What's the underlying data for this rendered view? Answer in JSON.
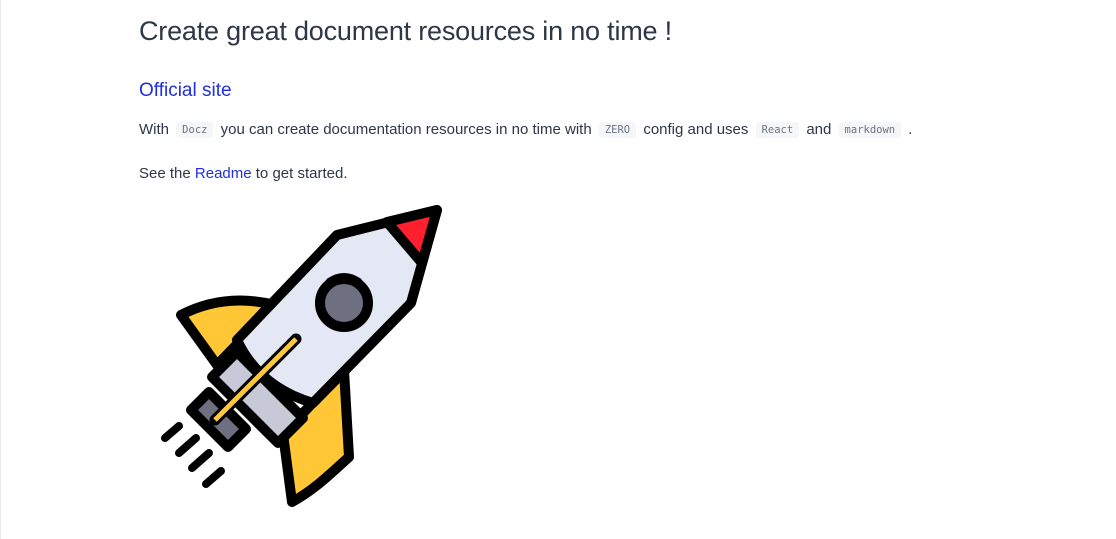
{
  "page": {
    "title": "Create great document resources in no time !"
  },
  "official_site": {
    "label": "Official site"
  },
  "intro": {
    "with": "With",
    "docz": "Docz",
    "mid1": "you can create documentation resources in no time with",
    "zero": "ZERO",
    "mid2": "config and uses",
    "react": "React",
    "and": "and",
    "markdown": "markdown",
    "end": "."
  },
  "readme_line": {
    "before": "See the",
    "link": "Readme",
    "after": "to get started."
  },
  "illustration": {
    "icon": "rocket-icon",
    "colors": {
      "body": "#e4e7f4",
      "window": "#6e6f80",
      "nose": "#ff1f2e",
      "fins": "#ffc636",
      "stripe": "#ffc636",
      "nozzle": "#c7cad6",
      "outline": "#000000"
    }
  },
  "colors": {
    "text": "#2d3747",
    "link": "#1f2fe0",
    "code_bg": "#f5f6f7",
    "code_text": "#6b7386"
  }
}
